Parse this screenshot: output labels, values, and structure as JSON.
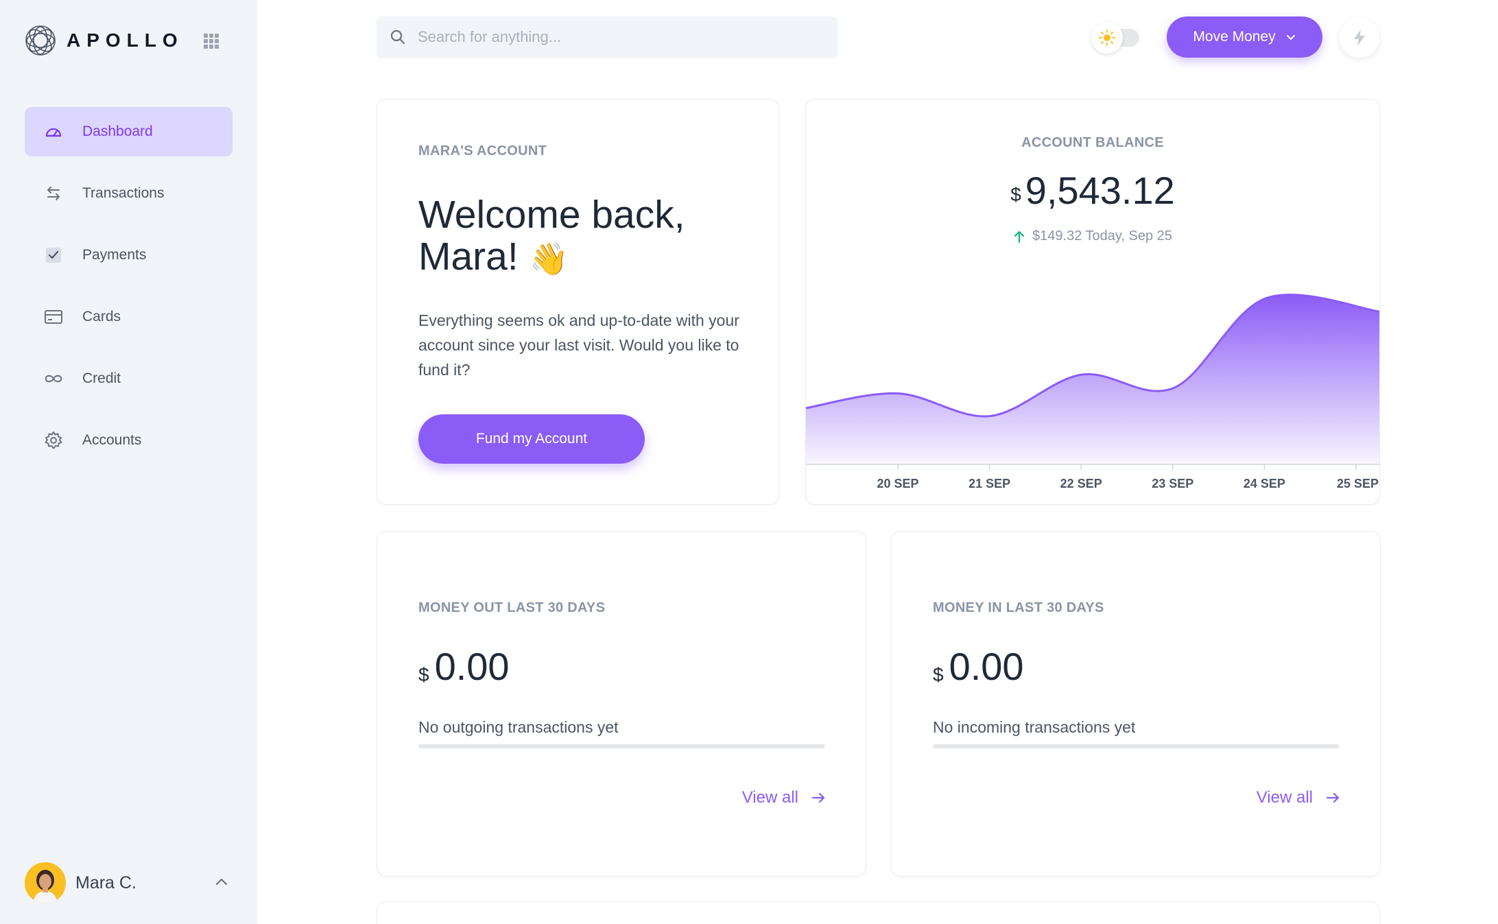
{
  "app": {
    "name": "APOLLO"
  },
  "sidebar": {
    "items": [
      {
        "label": "Dashboard",
        "icon": "gauge-icon",
        "active": true
      },
      {
        "label": "Transactions",
        "icon": "swap-icon",
        "active": false
      },
      {
        "label": "Payments",
        "icon": "check-square-icon",
        "active": false
      },
      {
        "label": "Cards",
        "icon": "credit-card-icon",
        "active": false
      },
      {
        "label": "Credit",
        "icon": "infinity-icon",
        "active": false
      },
      {
        "label": "Accounts",
        "icon": "gear-icon",
        "active": false
      }
    ],
    "user": {
      "name": "Mara C."
    }
  },
  "header": {
    "search_placeholder": "Search for anything...",
    "move_money_label": "Move Money"
  },
  "welcome": {
    "label": "MARA'S ACCOUNT",
    "title": "Welcome back, Mara!",
    "emoji": "👋",
    "body": "Everything seems ok and up-to-date with your account since your last visit. Would you like to fund it?",
    "button": "Fund my Account"
  },
  "balance": {
    "label": "ACCOUNT BALANCE",
    "currency": "$",
    "amount": "9,543.12",
    "change": "$149.32 Today, Sep 25"
  },
  "money_out": {
    "label": "MONEY OUT LAST 30 DAYS",
    "currency": "$",
    "amount": "0.00",
    "empty": "No outgoing transactions yet",
    "progress": 0,
    "view_all": "View all"
  },
  "money_in": {
    "label": "MONEY IN LAST 30 DAYS",
    "currency": "$",
    "amount": "0.00",
    "empty": "No incoming transactions yet",
    "progress": 0,
    "view_all": "View all"
  },
  "colors": {
    "accent": "#8b5cf6",
    "accent_light": "#ddd6fe",
    "positive": "#10b981",
    "sun": "#fbbf24"
  },
  "chart_data": {
    "type": "area",
    "categories": [
      "20 SEP",
      "21 SEP",
      "22 SEP",
      "23 SEP",
      "24 SEP",
      "25 SEP"
    ],
    "x": [
      "19 SEP",
      "20 SEP",
      "21 SEP",
      "22 SEP",
      "23 SEP",
      "24 SEP",
      "25 SEP"
    ],
    "values": [
      0.18,
      0.29,
      0.12,
      0.43,
      0.33,
      1.0,
      0.9
    ],
    "title": "",
    "xlabel": "",
    "ylabel": "",
    "y_axis": "hidden",
    "grid": false
  }
}
